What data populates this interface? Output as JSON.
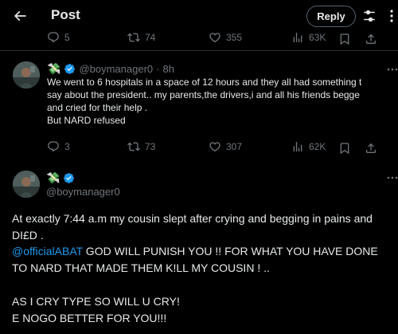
{
  "header": {
    "title": "Post",
    "reply_label": "Reply"
  },
  "top_actions": {
    "replies": "5",
    "reposts": "74",
    "likes": "355",
    "views": "63K"
  },
  "reply_tweet": {
    "emoji": "💸",
    "handle": "@boymanager0",
    "separator": "·",
    "time": "8h",
    "lines": [
      "We went to 6 hospitals in a space of 12 hours and they all had something t",
      "say about the president.. my parents,the drivers,i and all his friends begge",
      "and cried for their help .",
      "But NARD refused"
    ],
    "actions": {
      "replies": "3",
      "reposts": "73",
      "likes": "307",
      "views": "62K"
    }
  },
  "main_tweet": {
    "emoji": "💸",
    "handle": "@boymanager0",
    "lines": [
      "At exactly 7:44 a.m my cousin slept after crying and begging in pains and",
      "DI£D ."
    ],
    "mention": "@officialABAT",
    "mention_text": " GOD WILL PUNISH YOU !! FOR WHAT YOU HAVE DONE",
    "line4": "TO NARD THAT MADE THEM K!LL MY COUSIN ! ..",
    "line5": "AS I CRY TYPE SO WILL U CRY!",
    "line6": "E NOGO BETTER FOR YOU!!!"
  },
  "colors": {
    "background": "#000000",
    "text": "#e7e9ea",
    "muted": "#71767b",
    "accent": "#1d9bf0",
    "divider": "#2f3336"
  }
}
